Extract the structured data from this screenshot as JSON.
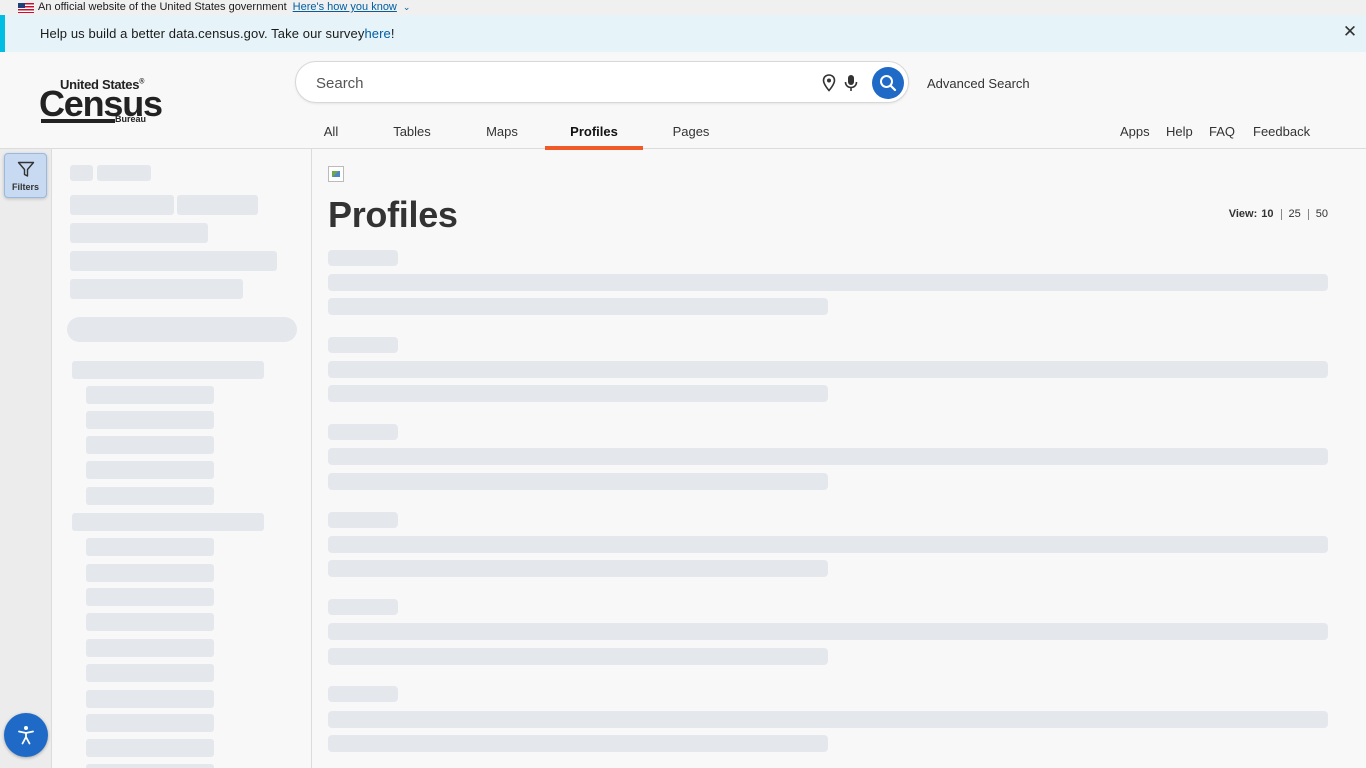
{
  "gov_banner": {
    "text": "An official website of the United States government",
    "link": "Here's how you know"
  },
  "survey_banner": {
    "text": "Help us build a better data.census.gov. Take our survey ",
    "link": "here",
    "suffix": "!"
  },
  "logo": {
    "top": "United States",
    "mark": "®",
    "main": "Census",
    "bottom": "Bureau"
  },
  "search": {
    "placeholder": "Search",
    "advanced_label": "Advanced Search"
  },
  "tabs": [
    {
      "label": "All",
      "active": false
    },
    {
      "label": "Tables",
      "active": false
    },
    {
      "label": "Maps",
      "active": false
    },
    {
      "label": "Profiles",
      "active": true
    },
    {
      "label": "Pages",
      "active": false
    }
  ],
  "utility_links": [
    "Apps",
    "Help",
    "FAQ",
    "Feedback"
  ],
  "rail": {
    "filters_label": "Filters"
  },
  "main": {
    "title": "Profiles",
    "view": {
      "label": "View:",
      "options": [
        "10",
        "25",
        "50"
      ],
      "selected": "10"
    }
  },
  "colors": {
    "accent_blue": "#1f6ac7",
    "active_tab_underline": "#f05a28",
    "survey_bar": "#00bde3",
    "skeleton": "#e4e7ec"
  }
}
